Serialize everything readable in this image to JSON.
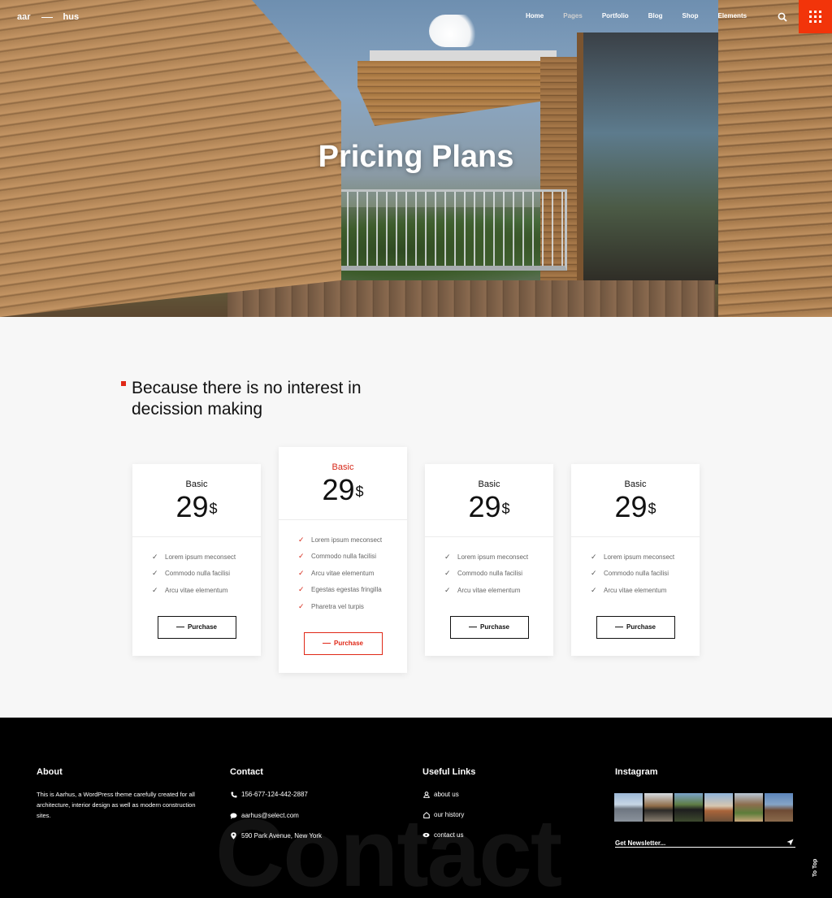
{
  "header": {
    "logo_left": "aar",
    "logo_right": "hus",
    "nav": [
      "Home",
      "Pages",
      "Portfolio",
      "Blog",
      "Shop",
      "Elements"
    ]
  },
  "hero": {
    "title": "Pricing Plans"
  },
  "section": {
    "heading": "Because there is no interest in decission making"
  },
  "pricing": {
    "plans": [
      {
        "name": "Basic",
        "price": "29",
        "currency": "$",
        "featured": false,
        "features": [
          "Lorem ipsum meconsect",
          "Commodo nulla facilisi",
          "Arcu vitae elementum"
        ],
        "button": "Purchase"
      },
      {
        "name": "Basic",
        "price": "29",
        "currency": "$",
        "featured": true,
        "features": [
          "Lorem ipsum meconsect",
          "Commodo nulla facilisi",
          "Arcu vitae elementum",
          "Egestas egestas fringilla",
          "Pharetra vel turpis"
        ],
        "button": "Purchase"
      },
      {
        "name": "Basic",
        "price": "29",
        "currency": "$",
        "featured": false,
        "features": [
          "Lorem ipsum meconsect",
          "Commodo nulla facilisi",
          "Arcu vitae elementum"
        ],
        "button": "Purchase"
      },
      {
        "name": "Basic",
        "price": "29",
        "currency": "$",
        "featured": false,
        "features": [
          "Lorem ipsum meconsect",
          "Commodo nulla facilisi",
          "Arcu vitae elementum"
        ],
        "button": "Purchase"
      }
    ]
  },
  "footer": {
    "about_title": "About",
    "about_text": "This is Aarhus, a WordPress theme carefully created for all architecture, interior design as well as modern construction sites.",
    "contact_title": "Contact",
    "phone": "156-677-124-442-2887",
    "email": "aarhus@select.com",
    "address": "590 Park Avenue, New York",
    "links_title": "Useful Links",
    "links": [
      "about us",
      "our history",
      "contact us"
    ],
    "instagram_title": "Instagram",
    "newsletter_placeholder": "Get Newsletter...",
    "background_word": "Contact",
    "to_top": "To Top"
  },
  "colors": {
    "accent": "#e02817",
    "menu_button": "#f2340a",
    "footer_bg": "#000000"
  }
}
